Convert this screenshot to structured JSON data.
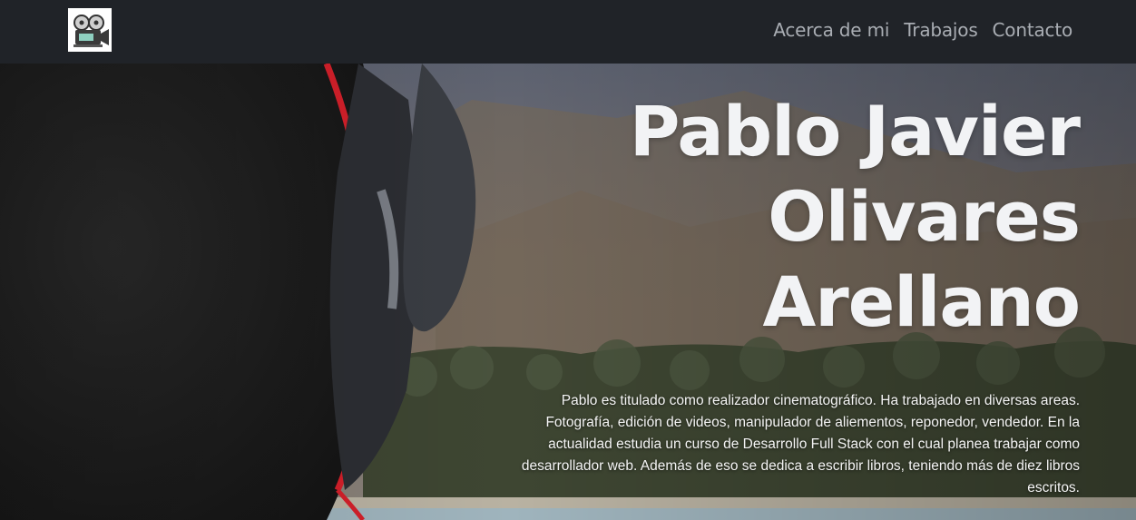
{
  "navbar": {
    "logo_icon": "film-camera-icon",
    "links": [
      {
        "label": "Acerca de mi"
      },
      {
        "label": "Trabajos"
      },
      {
        "label": "Contacto"
      }
    ]
  },
  "hero": {
    "title_lines": [
      "Pablo Javier",
      "Olivares",
      "Arellano"
    ],
    "bio": "Pablo es titulado como realizador cinematográfico. Ha trabajado en diversas areas. Fotografía, edición de videos, manipulador de aliementos, reponedor, vendedor. En la actualidad estudia un curso de Desarrollo Full Stack con el cual planea trabajar como desarrollador web. Además de eso se dedica a escribir libros, teniendo más de diez libros escritos."
  },
  "colors": {
    "navbar_bg": "#202328",
    "nav_link": "#a9adb3",
    "title": "#f2f3f5",
    "headphone_accent": "#d4202a"
  }
}
